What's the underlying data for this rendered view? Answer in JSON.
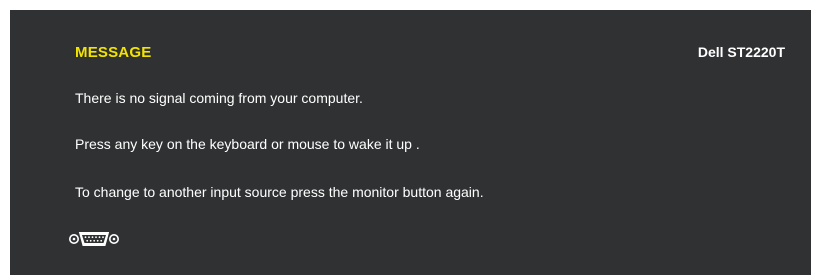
{
  "osd": {
    "title": "MESSAGE",
    "model": "Dell ST2220T",
    "lines": [
      "There is no signal coming from your computer.",
      "Press any key on the keyboard or mouse to wake it up .",
      "To change to another input source press the monitor button again."
    ],
    "input_icon": "vga-connector-icon"
  },
  "colors": {
    "panel_background": "#2f3133",
    "title_text": "#f3e400",
    "body_text": "#ffffff"
  }
}
